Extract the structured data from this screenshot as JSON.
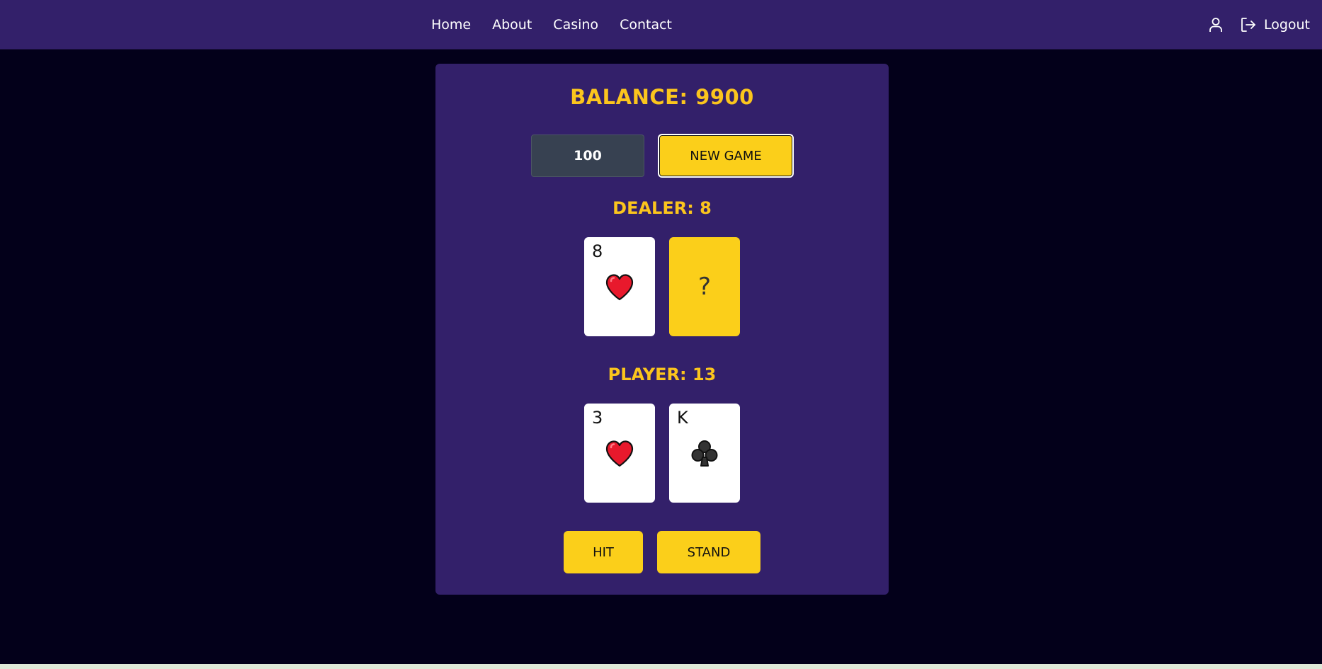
{
  "nav": {
    "links": [
      "Home",
      "About",
      "Casino",
      "Contact"
    ],
    "logout_label": "Logout",
    "icons": [
      "user-icon",
      "logout-icon"
    ]
  },
  "game": {
    "balance_text": "BALANCE: 9900",
    "bet_value": "100",
    "new_game_label": "NEW GAME",
    "dealer_score_text": "DEALER: 8",
    "player_score_text": "PLAYER: 13",
    "dealer_cards": [
      {
        "rank": "8",
        "suit": "heart"
      },
      {
        "hidden": true,
        "label": "?"
      }
    ],
    "player_cards": [
      {
        "rank": "3",
        "suit": "heart"
      },
      {
        "rank": "K",
        "suit": "club"
      }
    ],
    "hit_label": "HIT",
    "stand_label": "STAND"
  },
  "colors": {
    "background": "#03001a",
    "panel": "#33206a",
    "accent": "#fbcf1a",
    "heading": "#fbc51d",
    "heart": "#e8192c",
    "club": "#333333"
  }
}
